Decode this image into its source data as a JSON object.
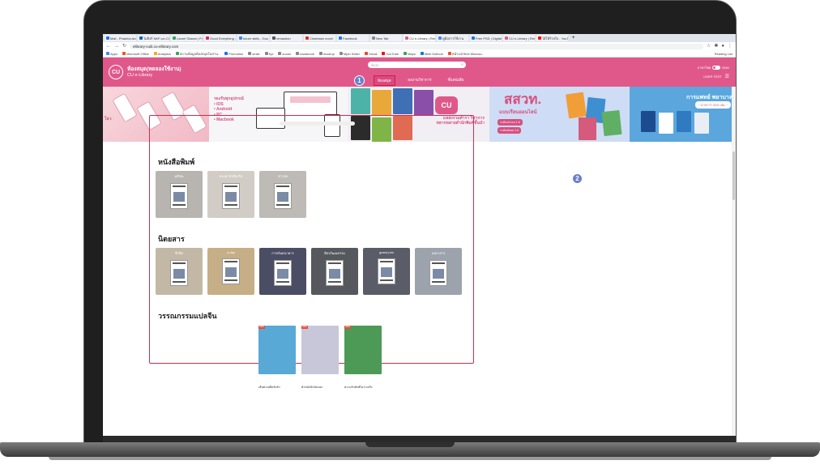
{
  "browser": {
    "tabs": [
      {
        "label": "Mail - Phatcha Arc",
        "color": "#1a73e8"
      },
      {
        "label": "ไม่ลิงก์ NKP-ue-Choic",
        "color": "#0a66c2"
      },
      {
        "label": "Laurel Shaam | Fr",
        "color": "#34a853"
      },
      {
        "label": "Good Everything -",
        "color": "#e0245e"
      },
      {
        "label": "future skills - Goo",
        "color": "#4285f4"
      },
      {
        "label": "remaction",
        "color": "#555555"
      },
      {
        "label": "Cimebase novel",
        "color": "#d93025"
      },
      {
        "label": "Facebook",
        "color": "#1877f2"
      },
      {
        "label": "New Tab",
        "color": "#888888"
      },
      {
        "label": "CU e-Library | Res",
        "color": "#e0588a"
      },
      {
        "label": "คู่มือการใช้งาน",
        "color": "#4285f4"
      },
      {
        "label": "Free PSD | Digital",
        "color": "#1a73e8"
      },
      {
        "label": "CU e-Library | Res",
        "color": "#e0588a"
      },
      {
        "label": "ไอ้ให้ร้ายใจ - YouTu",
        "color": "#ff0000"
      }
    ],
    "new_tab_label": "+",
    "url": "elibrary-cuib.cu-elibrary.com",
    "bookmarks": [
      "Apps",
      "Microsoft Office",
      "Analytics",
      "สถานข้อมูลห้องสมุดในป่าน..",
      "Promotion",
      "smile",
      "Kpi",
      "social",
      "chulabook",
      "mockup",
      "Mjob Seller",
      "Gmail",
      "YouTube",
      "Maps",
      "Mkill Outlook",
      "หน้าแรกของ Microso.."
    ],
    "reading_list": "Reading List"
  },
  "header": {
    "logo_text": "CU",
    "title": "ห้องสมุด(ทดลองใช้งาน)",
    "subtitle": "CU e-Library",
    "search_placeholder": "ค้นหา",
    "nav": [
      "ห้องสมุด",
      "ผลงานวิชาการ",
      "ชั้นหนังสือ"
    ],
    "lang_label": "ภาษาไทย",
    "lang_code": "ENG",
    "user_label": "USER TEST"
  },
  "badges": {
    "one": "1",
    "two": "2"
  },
  "banner": {
    "b1_tag": "โอว",
    "b2_title": "รองรับทุกอุปกรณ์",
    "b2_items": [
      "• IOS",
      "• Android",
      "• PC",
      "• Macbook"
    ],
    "b3_logo": "CU",
    "b3_text": [
      "แหล่งรวมตำรา วิชาการ",
      "หลากหลายสำนักพิมพ์ชั้นนำ"
    ],
    "b4_title": "สสวท.",
    "b4_subtitle": "แบบเรียนออนไลน์",
    "b4_pills": [
      "ระดับประถม 1-6",
      "ระดับมัธยม 1-6"
    ],
    "b5_title": "การแพทย์ พยาบาล",
    "b5_sub": "~ มากกว่า 500 เล่ม ~"
  },
  "sections": {
    "newspaper": {
      "title": "หนังสือพิมพ์",
      "items": [
        {
          "label": "มติชน",
          "bg": "#b8b5b0"
        },
        {
          "label": "ประชาชาติธุรกิจ",
          "bg": "#d1cdc6"
        },
        {
          "label": "ข่าวสด",
          "bg": "#bebab5"
        }
      ]
    },
    "magazine": {
      "title": "นิตยสาร",
      "items": [
        {
          "label": "ชีวจิต",
          "bg": "#c2b8a5"
        },
        {
          "label": "a day",
          "bg": "#c6ae86"
        },
        {
          "label": "การเงินธนาคาร",
          "bg": "#4a4d63"
        },
        {
          "label": "ศิลปวัฒนธรรม",
          "bg": "#55585d"
        },
        {
          "label": "grand prix",
          "bg": "#5a5c68"
        },
        {
          "label": "แพรวสาร",
          "bg": "#9da3ad"
        }
      ]
    },
    "literature": {
      "title": "วรรณกรรมแปลจีน",
      "new_tag": "NEW",
      "items": [
        {
          "label": "เส้นทางปลิดรักตัว",
          "bg": "#58a9d6"
        },
        {
          "label": "ตำหนักปักษ์นรอก",
          "bg": "#c8c6d9"
        },
        {
          "label": "ความรักยักษ์ไม่ว่างจริง",
          "bg": "#4c9a55"
        }
      ]
    }
  },
  "colors": {
    "accent": "#e0588a",
    "highlight": "#d8294a",
    "badge": "#6b7ec8"
  }
}
